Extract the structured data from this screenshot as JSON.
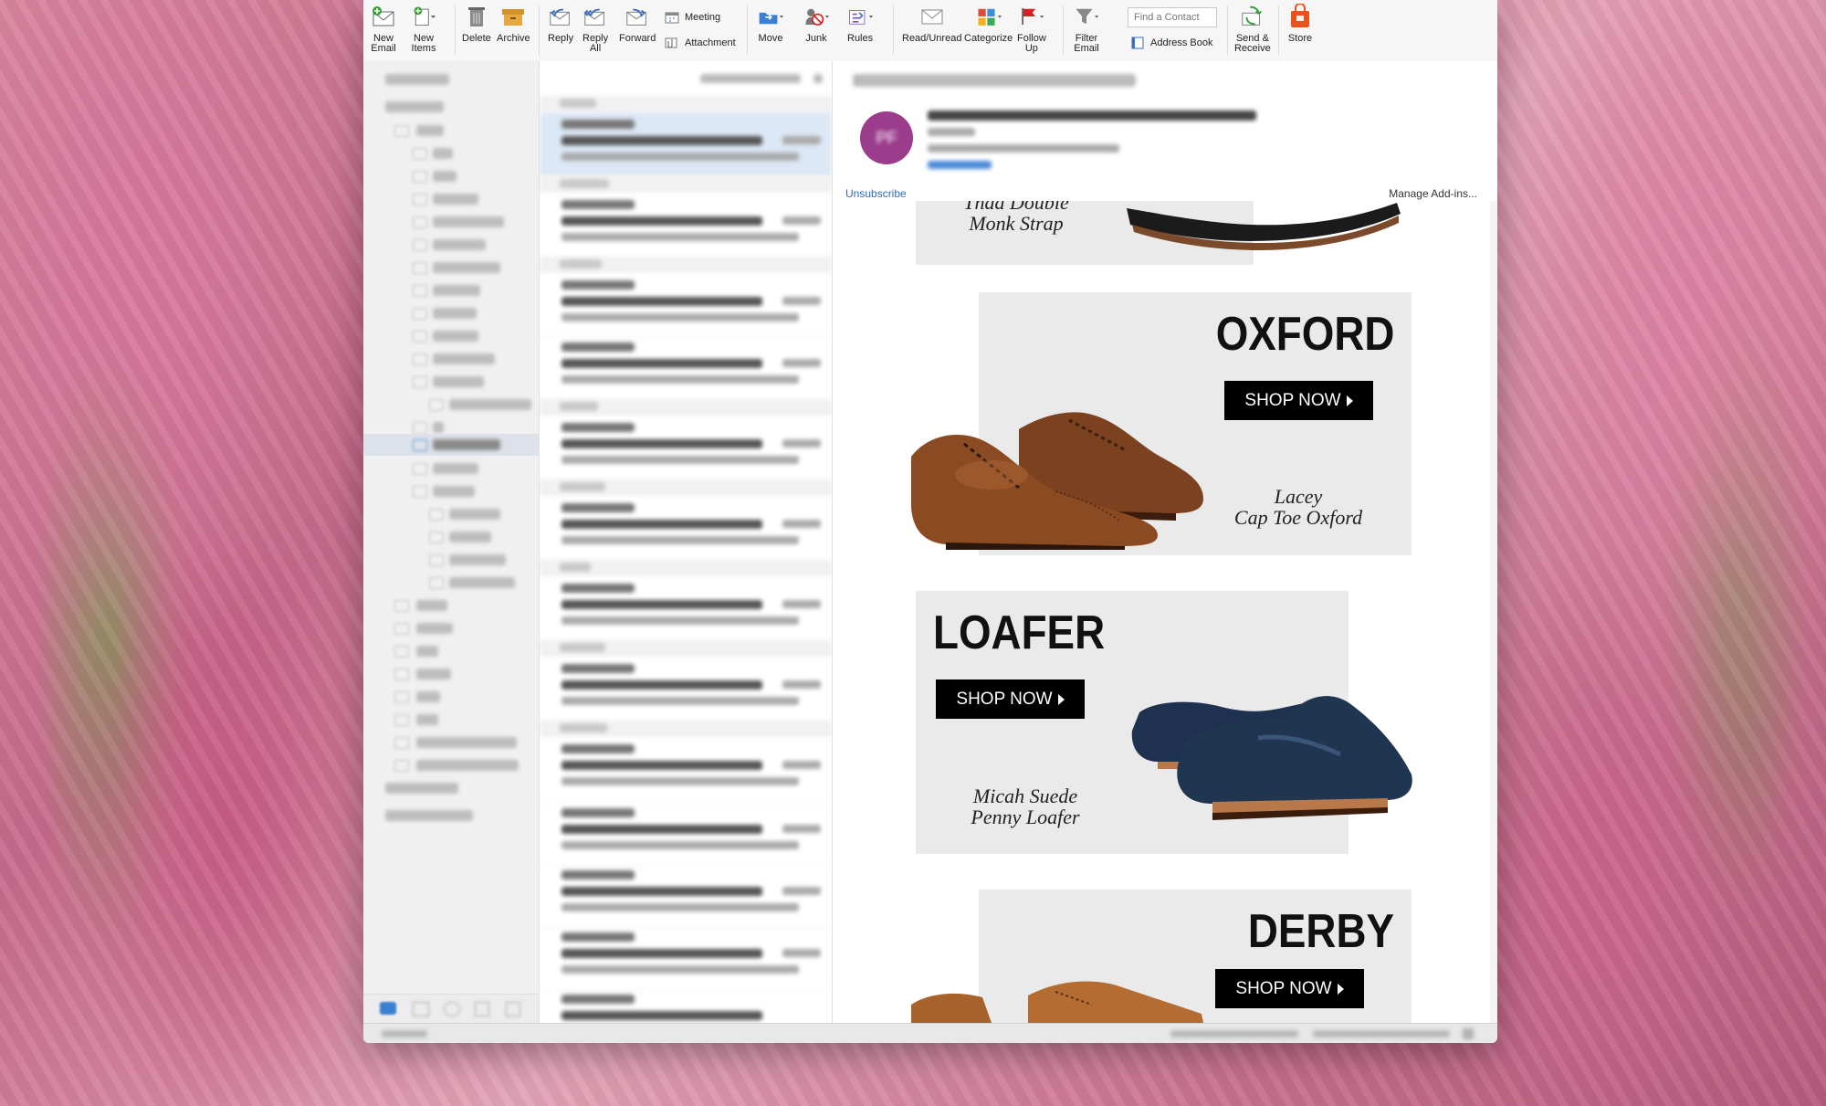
{
  "ribbon": {
    "new_email": [
      "New",
      "Email"
    ],
    "new_items": [
      "New",
      "Items"
    ],
    "delete": "Delete",
    "archive": "Archive",
    "reply": "Reply",
    "reply_all": [
      "Reply",
      "All"
    ],
    "forward": "Forward",
    "meeting": "Meeting",
    "attachment": "Attachment",
    "move": "Move",
    "junk": "Junk",
    "rules": "Rules",
    "read_unread": "Read/Unread",
    "categorize": "Categorize",
    "follow_up": [
      "Follow",
      "Up"
    ],
    "filter_email": [
      "Filter",
      "Email"
    ],
    "find_contact_placeholder": "Find a Contact",
    "address_book": "Address Book",
    "send_receive": [
      "Send &",
      "Receive"
    ],
    "store": "Store"
  },
  "reading_pane": {
    "avatar_initials": "PF",
    "unsubscribe": "Unsubscribe",
    "manage_addins": "Manage Add-ins..."
  },
  "email": {
    "top_product": [
      "Thad Double",
      "Monk Strap"
    ],
    "sections": [
      {
        "title": "OXFORD",
        "cta": "SHOP NOW",
        "product": [
          "Lacey",
          "Cap Toe Oxford"
        ]
      },
      {
        "title": "LOAFER",
        "cta": "SHOP NOW",
        "product": [
          "Micah Suede",
          "Penny Loafer"
        ]
      },
      {
        "title": "DERBY",
        "cta": "SHOP NOW"
      }
    ]
  },
  "colors": {
    "accent_blue": "#2a6cc2",
    "avatar_purple": "#9b3d8c",
    "shoe_brown": "#8a4a22",
    "shoe_navy": "#1f3550"
  }
}
